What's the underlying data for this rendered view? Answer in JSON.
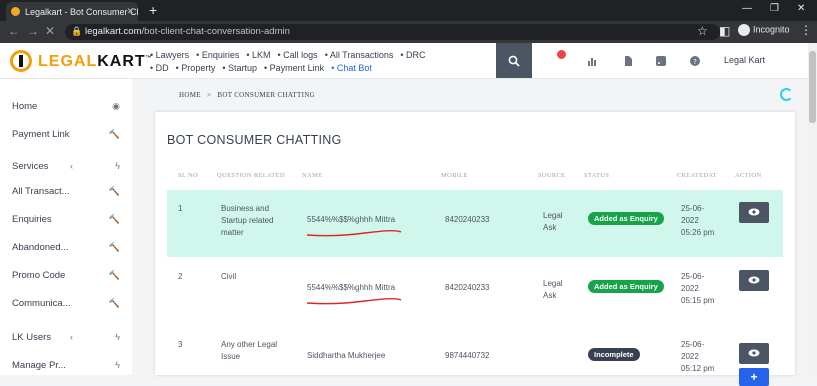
{
  "browser": {
    "tab_title": "Legalkart - Bot Consumer Chatting",
    "url_domain": "legalkart.com",
    "url_path": "/bot-client-chat-conversation-admin",
    "profile_label": "Incognito"
  },
  "header": {
    "logo_text_a": "LEGAL",
    "logo_text_b": "KART",
    "menu": [
      "Lawyers",
      "Enquiries",
      "LKM",
      "Call logs",
      "All Transactions",
      "DRC",
      "DD",
      "Property",
      "Startup",
      "Payment Link",
      "Chat Bot"
    ],
    "active_menu": "Chat Bot",
    "user": "Legal Kart",
    "notification_color": "#ef4444"
  },
  "sidebar": {
    "items": [
      {
        "label": "Home",
        "icon": "dashboard-icon"
      },
      {
        "label": "Payment Link",
        "icon": "gavel-icon"
      },
      {
        "label": "Services",
        "icon": "bolt-icon",
        "expandable": true
      },
      {
        "label": "All Transact...",
        "icon": "gavel-icon"
      },
      {
        "label": "Enquiries",
        "icon": "gavel-icon"
      },
      {
        "label": "Abandoned...",
        "icon": "gavel-icon"
      },
      {
        "label": "Promo Code",
        "icon": "gavel-icon"
      },
      {
        "label": "Communica...",
        "icon": "gavel-icon"
      },
      {
        "label": "LK Users",
        "icon": "bolt-icon",
        "expandable": true
      },
      {
        "label": "Manage Pr...",
        "icon": "bolt-icon"
      }
    ]
  },
  "breadcrumb": {
    "home": "HOME",
    "separator": ">",
    "current": "BOT CONSUMER CHATTING"
  },
  "card": {
    "title": "BOT CONSUMER CHATTING",
    "columns": [
      "SL NO",
      "QUESTION RELATED",
      "NAME",
      "MOBILE",
      "SOURCE",
      "STATUS",
      "CREATEDAT",
      "ACTION"
    ],
    "rows": [
      {
        "sl": "1",
        "question": "Business and Startup related matter",
        "name": "5544%%$$%ghhh Mittra",
        "mobile": "8420240233",
        "source": "Legal Ask",
        "status": "Added as Enquiry",
        "status_color": "#16a34a",
        "created": "25-06-2022 05:26 pm",
        "highlighted": true
      },
      {
        "sl": "2",
        "question": "Civil",
        "name": "5544%%$$%ghhh Mittra",
        "mobile": "8420240233",
        "source": "Legal Ask",
        "status": "Added as Enquiry",
        "status_color": "#16a34a",
        "created": "25-06-2022 05:15 pm",
        "highlighted": false
      },
      {
        "sl": "3",
        "question": "Any other Legal Issue",
        "name": "Siddhartha Mukherjee",
        "mobile": "9874440732",
        "source": "",
        "status": "Incomplete",
        "status_color": "#374151",
        "created": "25-06-2022 05:12 pm",
        "highlighted": false
      }
    ],
    "annotation_color": "#dc2626"
  }
}
